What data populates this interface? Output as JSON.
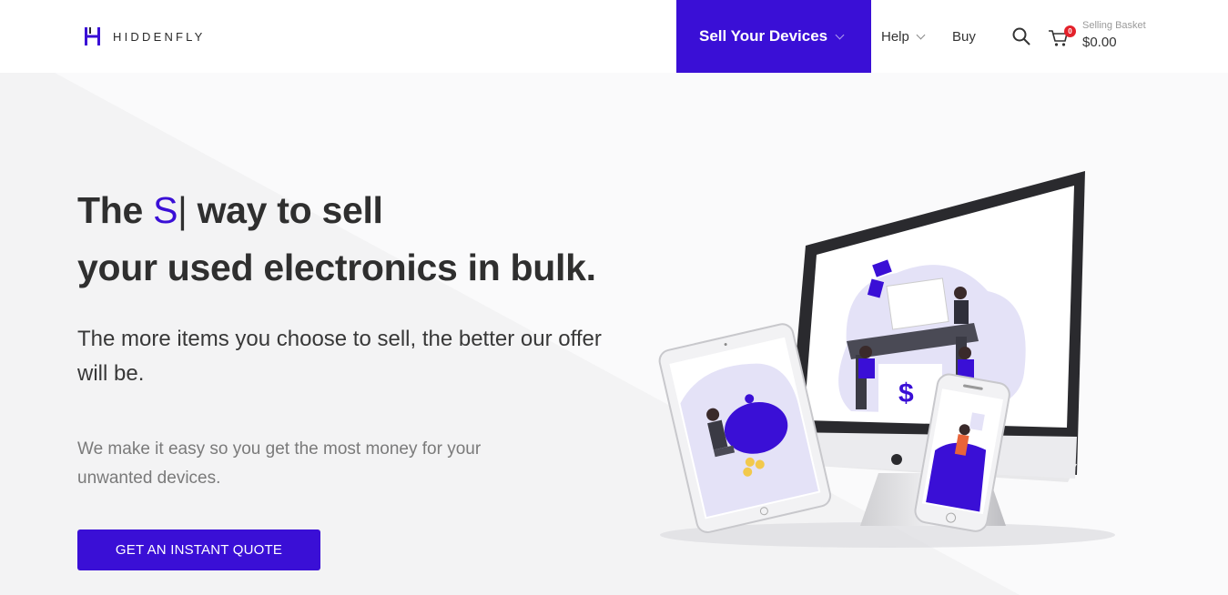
{
  "header": {
    "brand": "HIDDENFLY",
    "nav": {
      "sell_label": "Sell Your Devices",
      "help_label": "Help",
      "buy_label": "Buy"
    },
    "basket": {
      "count": "0",
      "label": "Selling Basket",
      "total": "$0.00"
    }
  },
  "hero": {
    "headline_pre": "The ",
    "headline_typed": "S",
    "headline_cursor": "|",
    "headline_post": " way to sell",
    "headline_line2": "your used electronics in bulk.",
    "subhead": "The more items you choose to sell, the better our offer will be.",
    "description": "We make it easy so you get the most money for your unwanted devices.",
    "cta_label": "GET AN INSTANT QUOTE",
    "illustration_dollar": "$"
  },
  "colors": {
    "accent": "#3a0fd6",
    "badge": "#e3222b"
  },
  "icons": [
    "brand-logo-icon",
    "chevron-down-icon",
    "search-icon",
    "cart-icon"
  ]
}
